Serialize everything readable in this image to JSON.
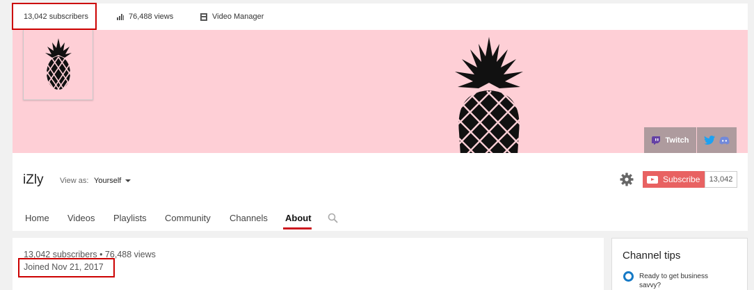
{
  "topbar": {
    "subscribers": "13,042 subscribers",
    "views": "76,488 views",
    "video_manager": "Video Manager"
  },
  "banner": {
    "twitch_label": "Twitch",
    "colors": {
      "background": "#fecfd6"
    }
  },
  "channel": {
    "name": "iZly",
    "view_as_label": "View as:",
    "view_as_value": "Yourself",
    "subscribe_label": "Subscribe",
    "subscribe_count": "13,042"
  },
  "tabs": [
    {
      "label": "Home"
    },
    {
      "label": "Videos"
    },
    {
      "label": "Playlists"
    },
    {
      "label": "Community"
    },
    {
      "label": "Channels"
    },
    {
      "label": "About",
      "active": true
    }
  ],
  "about": {
    "stats": "13,042 subscribers • 76,488 views",
    "joined": "Joined Nov 21, 2017"
  },
  "tips": {
    "title": "Channel tips",
    "item": "Ready to get business savvy?"
  },
  "icons": [
    "bar-chart-icon",
    "video-manager-icon",
    "pineapple-logo",
    "twitch-icon",
    "twitter-icon",
    "discord-icon",
    "gear-icon",
    "youtube-play-icon",
    "search-icon"
  ],
  "accent_colors": {
    "subscribe": "#e86262",
    "active_tab": "#cc181e",
    "highlight_box": "#cc0000",
    "tip_ring": "#167ac6"
  }
}
